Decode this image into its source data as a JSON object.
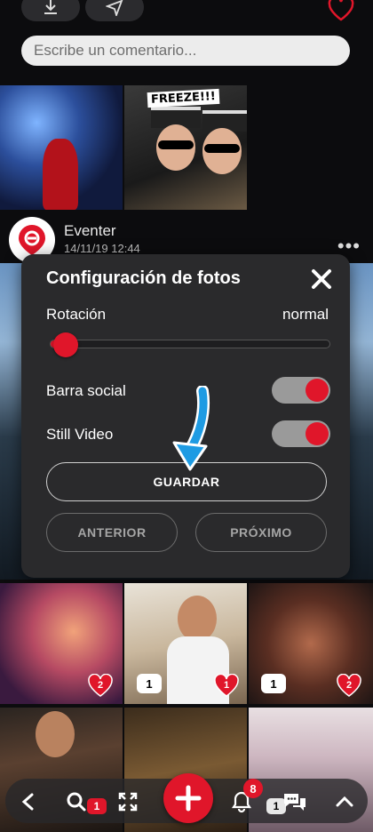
{
  "comment": {
    "placeholder": "Escribe un comentario..."
  },
  "top_photos": {
    "sticker_text": "FREEZE!!!"
  },
  "post": {
    "author": "Eventer",
    "timestamp": "14/11/19 12:44"
  },
  "modal": {
    "title": "Configuración de fotos",
    "rotation_label": "Rotación",
    "rotation_value": "normal",
    "rotation_slider_fraction": 0.06,
    "social_bar_label": "Barra social",
    "social_bar_on": true,
    "still_video_label": "Still Video",
    "still_video_on": true,
    "save_label": "GUARDAR",
    "prev_label": "ANTERIOR",
    "next_label": "PRÓXIMO"
  },
  "grid": [
    {
      "badge": "heart",
      "count": "2"
    },
    {
      "badges": [
        {
          "type": "comment",
          "count": "1"
        },
        {
          "type": "heart",
          "count": "1"
        }
      ]
    },
    {
      "badges": [
        {
          "type": "comment",
          "count": "1"
        },
        {
          "type": "heart",
          "count": "2"
        }
      ]
    }
  ],
  "nav": {
    "notifications_count": "8",
    "search_badge": "1",
    "photo_badge": "1"
  },
  "colors": {
    "accent": "#e0162a",
    "modal_bg": "#2a2a2c",
    "arrow_blue": "#1e9be3"
  }
}
